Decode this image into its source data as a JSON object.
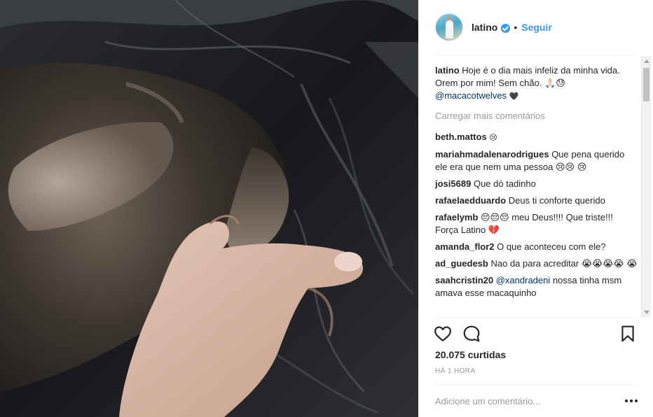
{
  "post": {
    "username": "latino",
    "verified": true,
    "separator": "•",
    "follow_label": "Seguir"
  },
  "caption": {
    "user": "latino",
    "text": "Hoje é o dia mais infeliz da minha vida. Orem por mim! Sem chão. 🙏🏻😓",
    "mention": "@macacotwelves",
    "trailing_emoji": "🖤"
  },
  "load_more_label": "Carregar mais comentários",
  "comments": [
    {
      "user": "beth.mattos",
      "text": "😢"
    },
    {
      "user": "mariahmadalenarodrigues",
      "text": "Que pena querido ele era que nem uma pessoa 😢😢 😢"
    },
    {
      "user": "josi5689",
      "text": "Que dó tadinho"
    },
    {
      "user": "rafaelaedduardo",
      "text": "Deus ti conforte querido"
    },
    {
      "user": "rafaelymb",
      "text": "😔😔😔 meu Deus!!!! Que triste!!! Força Latino 💔"
    },
    {
      "user": "amanda_flor2",
      "text": "O que aconteceu com ele?"
    },
    {
      "user": "ad_guedesb",
      "text": "Nao da para acreditar 😭😭😭😭 😭"
    },
    {
      "user": "saahcristin20",
      "mention": "@xandradeni",
      "text": "nossa tinha msm amava esse macaquinho"
    }
  ],
  "likes_label": "20.075 curtidas",
  "time_label": "HÁ 1 HORA",
  "add_comment_placeholder": "Adicione um comentário...",
  "icons": {
    "like": "heart-icon",
    "comment": "comment-bubble-icon",
    "save": "bookmark-icon",
    "more": "more-options-icon",
    "verified": "verified-badge-icon"
  },
  "colors": {
    "link_blue": "#3897f0",
    "mention_blue": "#003569",
    "muted_text": "#999999",
    "text": "#262626"
  }
}
